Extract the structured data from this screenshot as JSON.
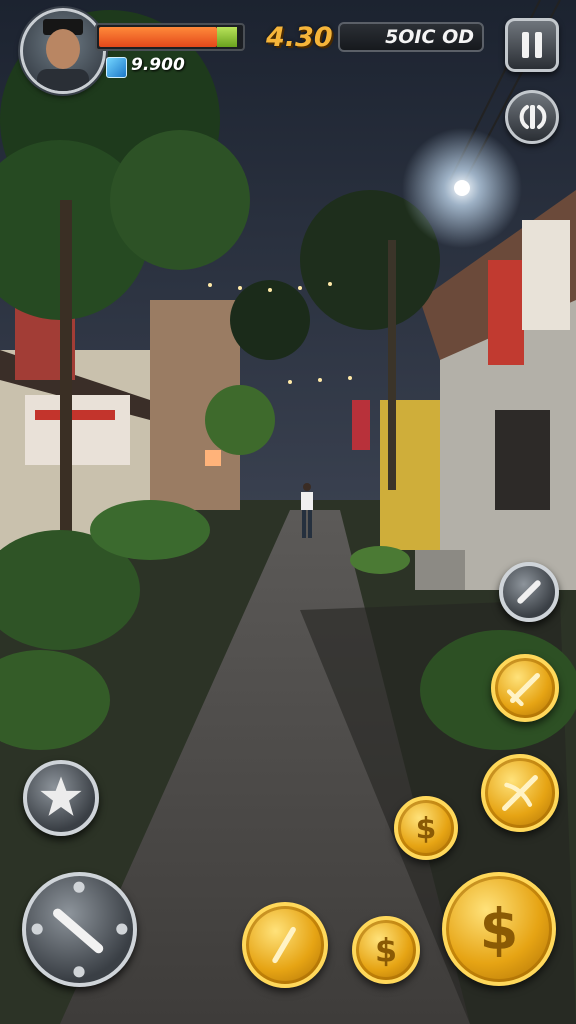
{
  "hud": {
    "health_percent": 0.97,
    "gems": "9.900",
    "timer": "4.30",
    "score": "5OIC OD"
  },
  "controls": {
    "left": [
      "star-special",
      "sword-attack"
    ],
    "right": [
      "weapon-slot-sword",
      "coin-small-1",
      "weapon-slot-crossbow",
      "coin-small-2",
      "coin-big",
      "coin-medium",
      "weapon-slot-stick"
    ]
  },
  "colors": {
    "health": "#e3481b",
    "timer": "#f6b53a",
    "gold": "#e6a414"
  }
}
